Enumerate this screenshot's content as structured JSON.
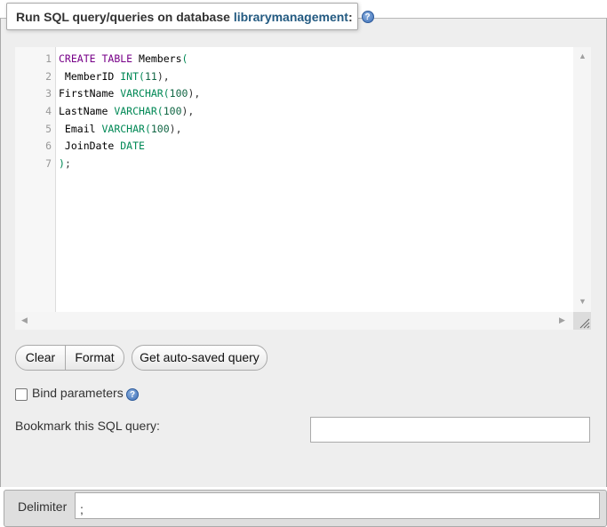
{
  "legend": {
    "prefix": "Run SQL query/queries on database",
    "database": "librarymanagement",
    "suffix": ":"
  },
  "editor": {
    "line_numbers": [
      "1",
      "2",
      "3",
      "4",
      "5",
      "6",
      "7"
    ],
    "lines": [
      [
        {
          "t": "CREATE",
          "c": "kw"
        },
        {
          "t": " "
        },
        {
          "t": "TABLE",
          "c": "kw"
        },
        {
          "t": " Members"
        },
        {
          "t": "(",
          "c": "ty"
        }
      ],
      [
        {
          "t": " MemberID "
        },
        {
          "t": "INT",
          "c": "ty"
        },
        {
          "t": "(",
          "c": "ty"
        },
        {
          "t": "11",
          "c": "nu"
        },
        {
          "t": "),",
          "c": "pu"
        }
      ],
      [
        {
          "t": "FirstName "
        },
        {
          "t": "VARCHAR",
          "c": "ty"
        },
        {
          "t": "(",
          "c": "ty"
        },
        {
          "t": "100",
          "c": "nu"
        },
        {
          "t": "),",
          "c": "pu"
        }
      ],
      [
        {
          "t": "LastName "
        },
        {
          "t": "VARCHAR",
          "c": "ty"
        },
        {
          "t": "(",
          "c": "ty"
        },
        {
          "t": "100",
          "c": "nu"
        },
        {
          "t": "),",
          "c": "pu"
        }
      ],
      [
        {
          "t": " Email "
        },
        {
          "t": "VARCHAR",
          "c": "ty"
        },
        {
          "t": "(",
          "c": "ty"
        },
        {
          "t": "100",
          "c": "nu"
        },
        {
          "t": "),",
          "c": "pu"
        }
      ],
      [
        {
          "t": " JoinDate "
        },
        {
          "t": "DATE",
          "c": "ty"
        }
      ],
      [
        {
          "t": ")",
          "c": "ty"
        },
        {
          "t": ";",
          "c": "pu"
        }
      ]
    ]
  },
  "buttons": {
    "clear": "Clear",
    "format": "Format",
    "autosave": "Get auto-saved query"
  },
  "bind_parameters": {
    "label": "Bind parameters",
    "checked": false
  },
  "bookmark": {
    "label": "Bookmark this SQL query:",
    "value": ""
  },
  "delimiter": {
    "label": "Delimiter",
    "value": ";"
  },
  "icons": {
    "help": "help-icon",
    "resize": "resize-grip-icon"
  },
  "colors": {
    "database_link": "#235a81",
    "keyword": "#770088",
    "type": "#008855"
  }
}
